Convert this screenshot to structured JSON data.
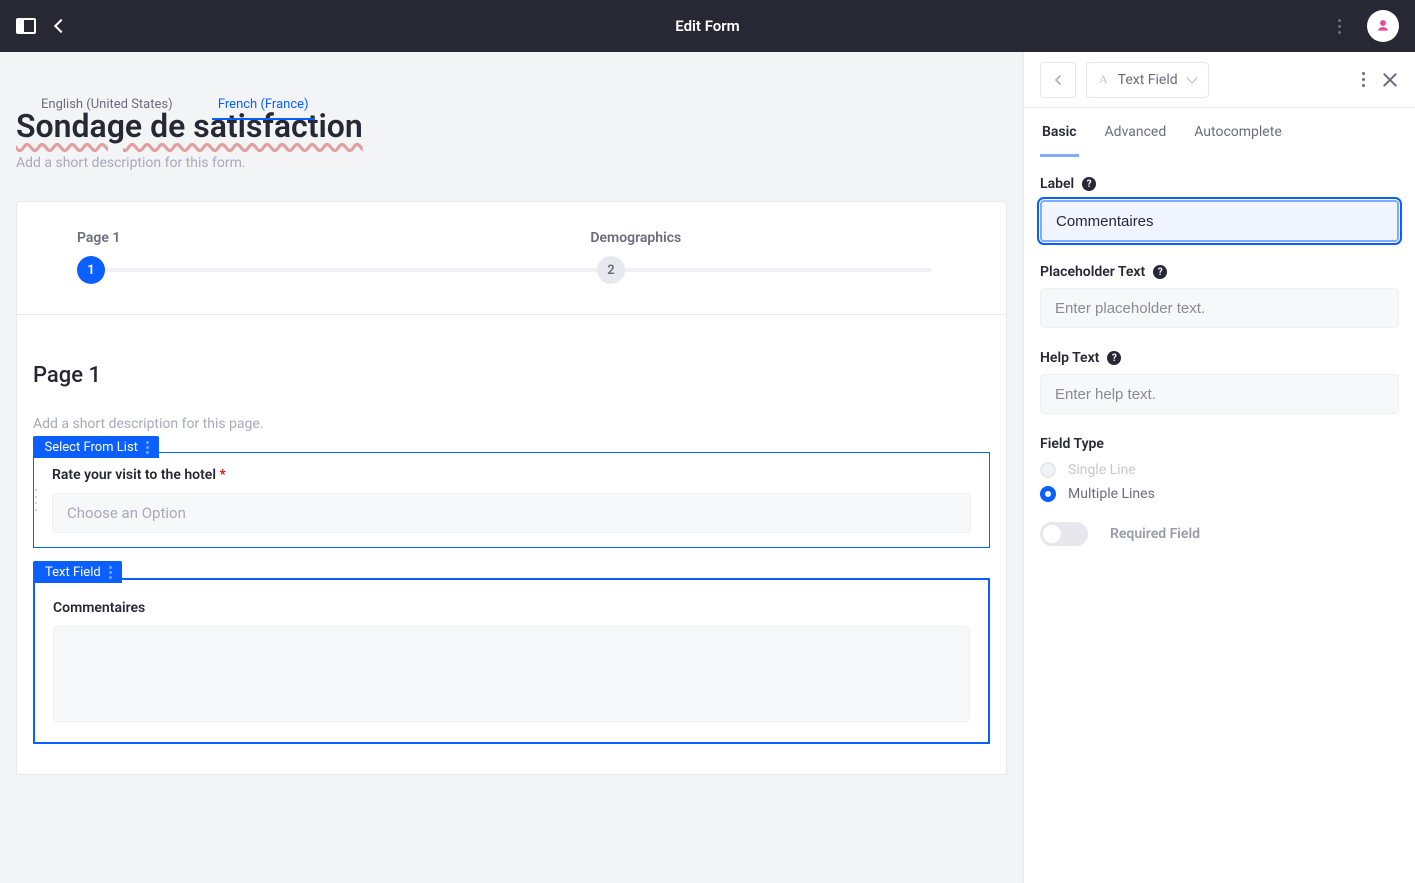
{
  "header": {
    "title": "Edit Form"
  },
  "langs": {
    "inactive": "English (United States)",
    "active": "French (France)"
  },
  "form": {
    "title": "Sondage de satisfaction",
    "description_placeholder": "Add a short description for this form."
  },
  "pager": {
    "p1_label": "Page 1",
    "p1_num": "1",
    "p2_label": "Demographics",
    "p2_num": "2"
  },
  "page": {
    "heading": "Page 1",
    "desc_placeholder": "Add a short description for this page."
  },
  "fields": {
    "select": {
      "chip": "Select From List",
      "label": "Rate your visit to the hotel",
      "required_mark": "*",
      "placeholder": "Choose an Option"
    },
    "text": {
      "chip": "Text Field",
      "label": "Commentaires"
    }
  },
  "sidebar": {
    "type_label": "Text Field",
    "tabs": {
      "basic": "Basic",
      "advanced": "Advanced",
      "autocomplete": "Autocomplete"
    },
    "label_lbl": "Label",
    "label_value": "Commentaires",
    "placeholder_lbl": "Placeholder Text",
    "placeholder_ph": "Enter placeholder text.",
    "help_lbl": "Help Text",
    "help_ph": "Enter help text.",
    "fieldtype_lbl": "Field Type",
    "single_line": "Single Line",
    "multi_line": "Multiple Lines",
    "required_lbl": "Required Field"
  }
}
